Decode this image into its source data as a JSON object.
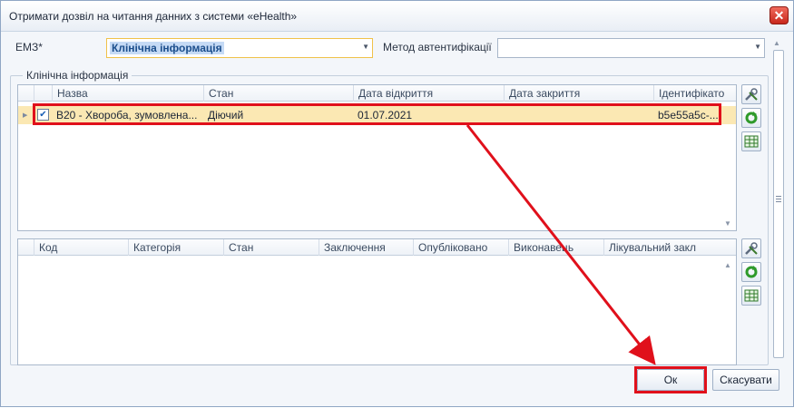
{
  "dialog": {
    "title": "Отримати дозвіл на читання данних з системи «eHealth»"
  },
  "form": {
    "emz_label": "ЕМЗ*",
    "emz_value": "Клінічна інформація",
    "auth_label": "Метод автентифікації",
    "auth_value": ""
  },
  "group": {
    "title": "Клінічна інформація"
  },
  "top_grid": {
    "columns": [
      "Назва",
      "Стан",
      "Дата відкриття",
      "Дата закриття",
      "Ідентифікато"
    ],
    "rows": [
      {
        "checked": true,
        "name": "B20 - Хвороба, зумовлена...",
        "status": "Діючий",
        "opened": "01.07.2021",
        "closed": "",
        "id": "b5e55a5c-..."
      }
    ]
  },
  "bottom_grid": {
    "columns": [
      "Код",
      "Категорія",
      "Стан",
      "Заключення",
      "Опубліковано",
      "Виконавець",
      "Лікувальний закл"
    ]
  },
  "buttons": {
    "ok": "Ок",
    "cancel": "Скасувати"
  },
  "icons": {
    "close": "close-icon",
    "tools": "tools-icon",
    "refresh": "refresh-icon",
    "table": "table-icon"
  },
  "colors": {
    "highlight": "#e0101b",
    "selected_row": "#fbe8b3",
    "focus_border": "#f0c24a"
  }
}
